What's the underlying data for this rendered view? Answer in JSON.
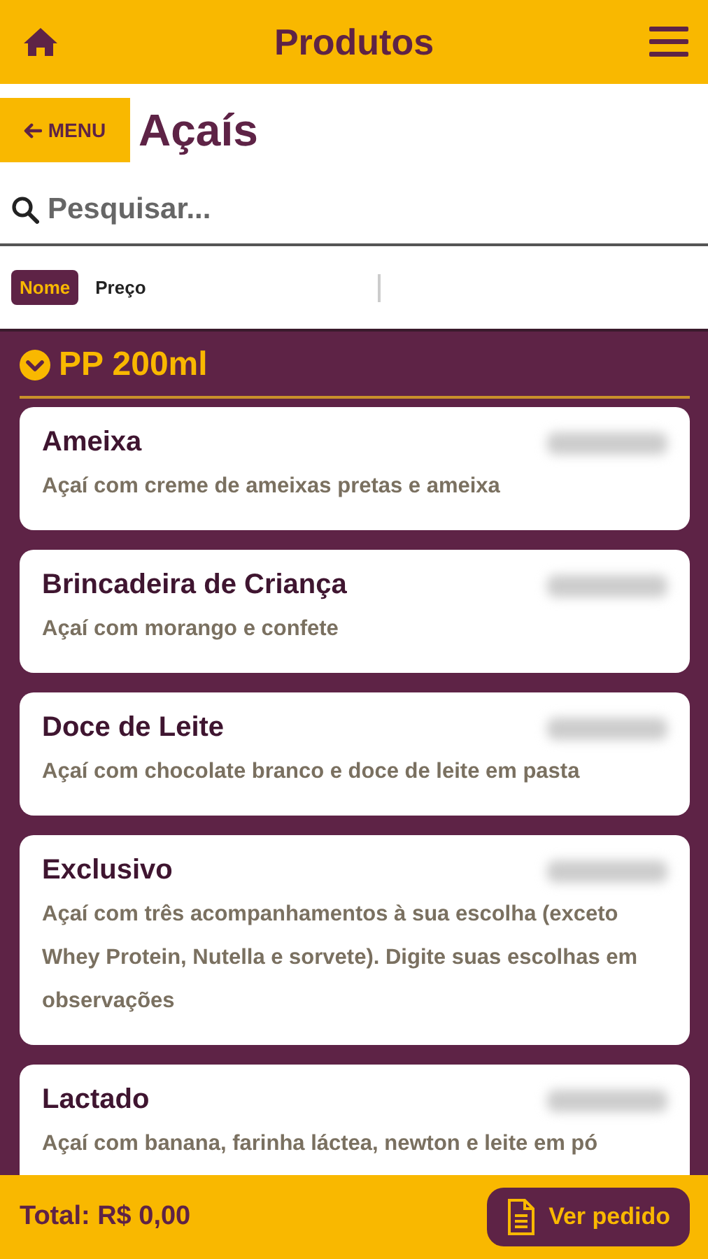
{
  "header": {
    "title": "Produtos"
  },
  "category": {
    "back_label": "MENU",
    "title": "Açaís"
  },
  "search": {
    "placeholder": "Pesquisar..."
  },
  "sort": [
    {
      "label": "Nome",
      "selected": true
    },
    {
      "label": "Preço",
      "selected": false
    }
  ],
  "section": {
    "title": "PP 200ml",
    "expanded": true
  },
  "products": [
    {
      "name": "Ameixa",
      "description": "Açaí com creme de ameixas pretas e ameixa"
    },
    {
      "name": "Brincadeira de Criança",
      "description": "Açaí com morango e confete"
    },
    {
      "name": "Doce de Leite",
      "description": "Açaí com chocolate branco e doce de leite em pasta"
    },
    {
      "name": "Exclusivo",
      "description": "Açaí com três acompanhamentos à sua escolha (exceto Whey Protein, Nutella e sorvete). Digite suas escolhas em observações"
    },
    {
      "name": "Lactado",
      "description": "Açaí com banana, farinha láctea, newton e leite em pó"
    }
  ],
  "footer": {
    "total": "Total: R$ 0,00",
    "button": "Ver pedido"
  }
}
